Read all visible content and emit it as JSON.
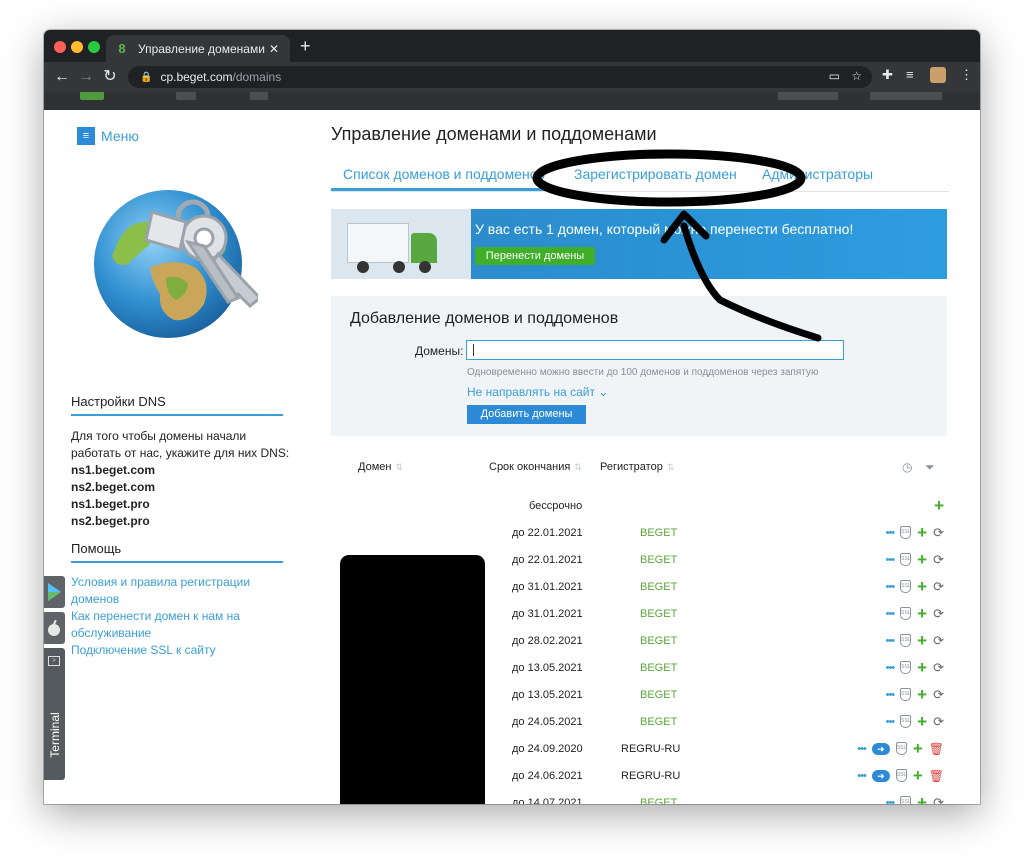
{
  "browser": {
    "tab_title": "Управление доменами | Пане",
    "tab_close": "✕",
    "new_tab": "+",
    "url_host": "cp.beget.com",
    "url_path": "/domains"
  },
  "sidebar": {
    "menu_label": "Меню",
    "dns_heading": "Настройки DNS",
    "dns_text": "Для того чтобы домены начали работать от нас, укажите для них DNS:",
    "dns_servers": [
      "ns1.beget.com",
      "ns2.beget.com",
      "ns1.beget.pro",
      "ns2.beget.pro"
    ],
    "help_heading": "Помощь",
    "help_links": [
      "Условия и правила регистрации доменов",
      "Как перенести домен к нам на обслуживание",
      "Подключение SSL к сайту"
    ],
    "terminal_label": "Terminal"
  },
  "main": {
    "title": "Управление доменами и поддоменами",
    "tabs": [
      "Список доменов и поддоменов",
      "Зарегистрировать домен",
      "Администраторы"
    ],
    "banner": {
      "text": "У вас есть 1 домен, который можно перенести бесплатно!",
      "button": "Перенести домены"
    },
    "add": {
      "heading": "Добавление доменов и поддоменов",
      "label": "Домены:",
      "hint": "Одновременно можно ввести до 100 доменов и поддоменов через запятую",
      "redirect": "Не направлять на сайт ⌄",
      "button": "Добавить домены"
    },
    "table": {
      "col_domain": "Домен",
      "col_expiry": "Срок окончания",
      "col_registrar": "Регистратор",
      "rows": [
        {
          "date": "бессрочно",
          "registrar": ""
        },
        {
          "date": "до 22.01.2021",
          "registrar": "BEGET"
        },
        {
          "date": "до 22.01.2021",
          "registrar": "BEGET"
        },
        {
          "date": "до 31.01.2021",
          "registrar": "BEGET"
        },
        {
          "date": "до 31.01.2021",
          "registrar": "BEGET"
        },
        {
          "date": "до 28.02.2021",
          "registrar": "BEGET"
        },
        {
          "date": "до 13.05.2021",
          "registrar": "BEGET"
        },
        {
          "date": "до 13.05.2021",
          "registrar": "BEGET"
        },
        {
          "date": "до 24.05.2021",
          "registrar": "BEGET"
        },
        {
          "date": "до 24.09.2020",
          "registrar": "REGRU-RU"
        },
        {
          "date": "до 24.06.2021",
          "registrar": "REGRU-RU"
        },
        {
          "date": "до 14.07.2021",
          "registrar": "BEGET"
        }
      ]
    }
  },
  "colors": {
    "accent": "#3a9ed8",
    "beget_green": "#5aa63a",
    "chrome_dark": "#202124"
  }
}
